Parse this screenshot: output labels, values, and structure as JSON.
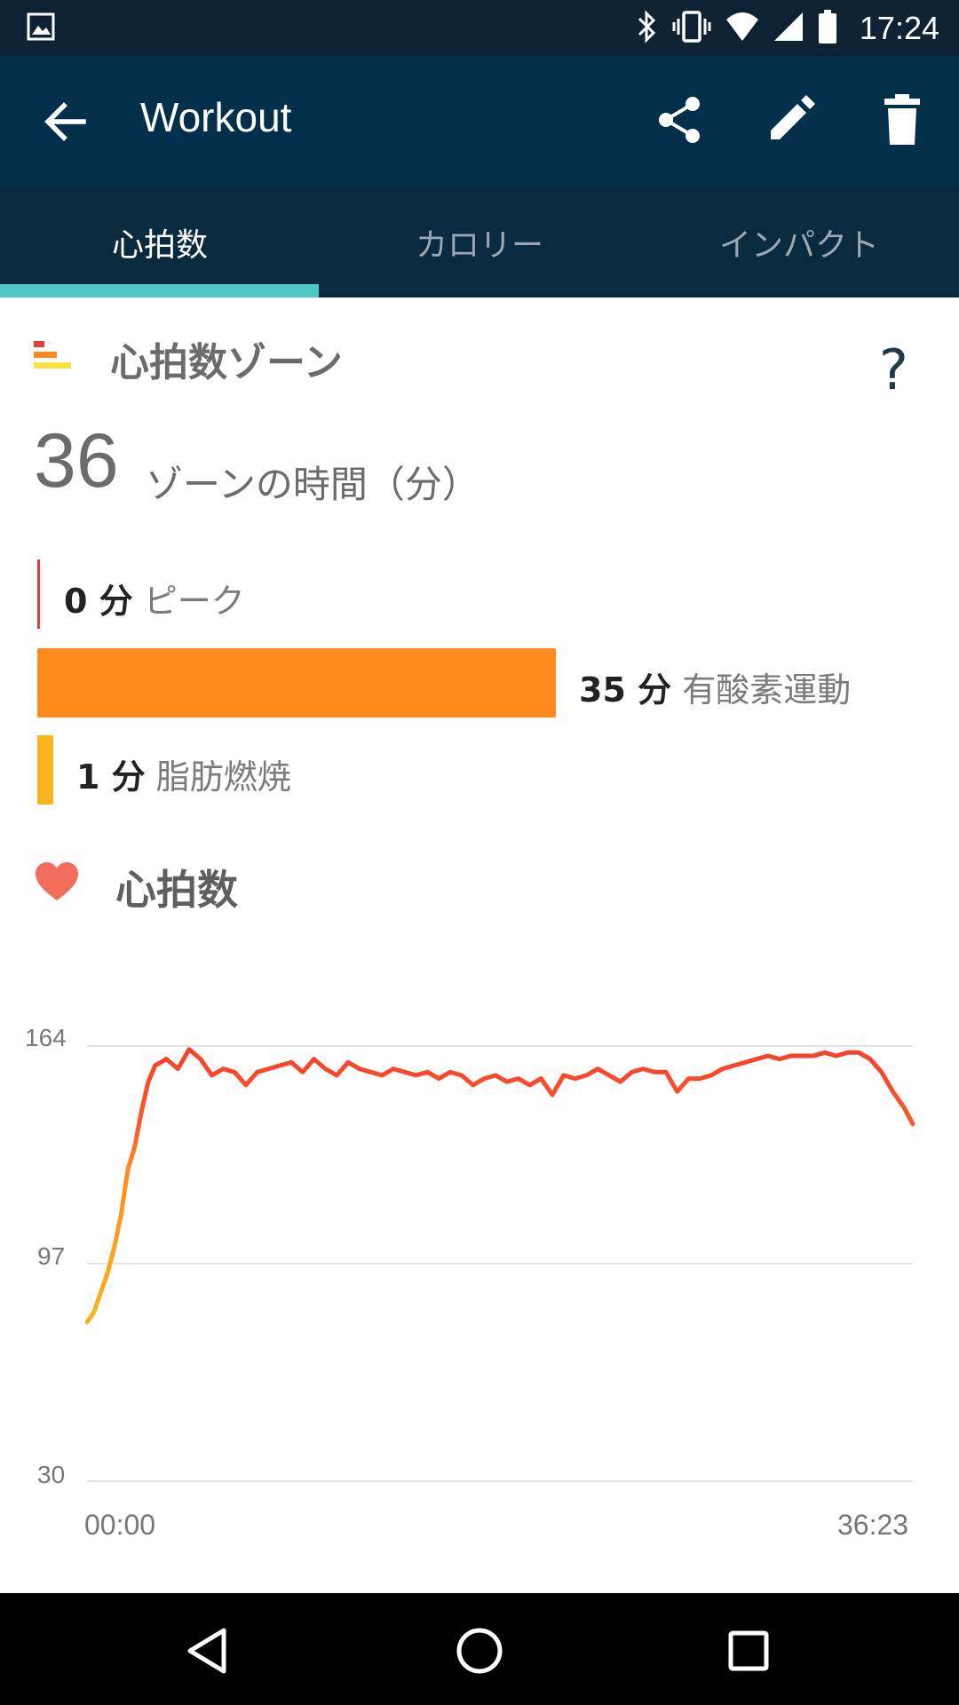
{
  "status_bar": {
    "time": "17:24"
  },
  "app_bar": {
    "title": "Workout"
  },
  "tabs": [
    {
      "label": "心拍数",
      "active": true
    },
    {
      "label": "カロリー",
      "active": false
    },
    {
      "label": "インパクト",
      "active": false
    }
  ],
  "zones": {
    "title": "心拍数ゾーン",
    "help": "?",
    "total_minutes": "36",
    "total_label": "ゾーンの時間（分）",
    "items": [
      {
        "minutes": "0 分",
        "name": "ピーク",
        "color": "#e53b3b",
        "value": 0
      },
      {
        "minutes": "35 分",
        "name": "有酸素運動",
        "color": "#ff8b1f",
        "value": 35
      },
      {
        "minutes": "1 分",
        "name": "脂肪燃焼",
        "color": "#fbb41e",
        "value": 1
      }
    ]
  },
  "heart_rate": {
    "title": "心拍数",
    "icon_color": "#f26d5b"
  },
  "chart_data": {
    "type": "line",
    "y_ticks": [
      "164",
      "97",
      "30"
    ],
    "ylim": [
      30,
      164
    ],
    "x_start_label": "00:00",
    "x_end_label": "36:23",
    "xlim": [
      0,
      36.38
    ],
    "series": [
      {
        "x": [
          0,
          0.3,
          0.6,
          0.9,
          1.2,
          1.5,
          1.8,
          2.1,
          2.4,
          2.7,
          3.0,
          3.5,
          4.0,
          4.5,
          5.0,
          5.5,
          6.0,
          6.5,
          7.0,
          7.5,
          8.0,
          8.5,
          9.0,
          9.5,
          10.0,
          10.5,
          11.0,
          11.5,
          12.0,
          12.5,
          13.0,
          13.5,
          14.0,
          14.5,
          15.0,
          15.5,
          16.0,
          16.5,
          17.0,
          17.5,
          18.0,
          18.5,
          19.0,
          19.5,
          20.0,
          20.5,
          21.0,
          21.5,
          22.0,
          22.5,
          23.0,
          23.5,
          24.0,
          24.5,
          25.0,
          25.5,
          26.0,
          26.5,
          27.0,
          27.5,
          28.0,
          28.5,
          29.0,
          29.5,
          30.0,
          30.5,
          31.0,
          31.5,
          32.0,
          32.5,
          33.0,
          33.5,
          34.0,
          34.5,
          35.0,
          35.5,
          36.0,
          36.38
        ],
        "y": [
          79,
          82,
          88,
          94,
          102,
          112,
          126,
          133,
          144,
          153,
          158,
          160,
          157,
          163,
          160,
          155,
          157,
          156,
          152,
          156,
          157,
          158,
          159,
          156,
          160,
          157,
          155,
          159,
          157,
          156,
          155,
          157,
          156,
          155,
          156,
          154,
          156,
          155,
          152,
          154,
          155,
          153,
          154,
          152,
          154,
          149,
          155,
          154,
          155,
          157,
          155,
          153,
          156,
          157,
          156,
          156,
          150,
          154,
          154,
          155,
          157,
          158,
          159,
          160,
          161,
          160,
          161,
          161,
          161,
          162,
          161,
          162,
          162,
          160,
          156,
          150,
          145,
          140
        ],
        "zones": "orange below ~120, red above"
      }
    ]
  }
}
